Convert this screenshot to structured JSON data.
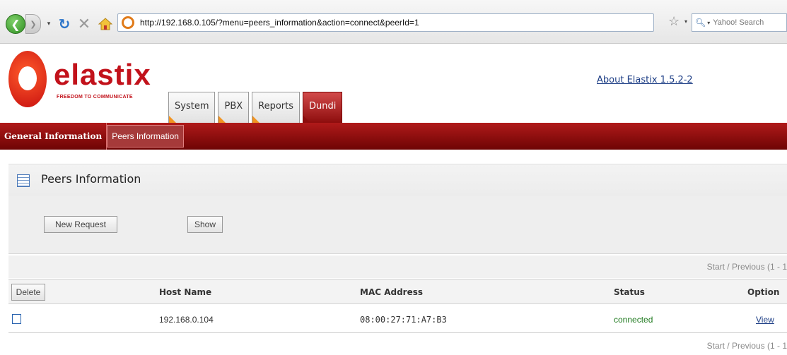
{
  "browser": {
    "url": "http://192.168.0.105/?menu=peers_information&action=connect&peerId=1",
    "search_placeholder": "Yahoo! Search"
  },
  "header": {
    "logo_text": "elastix",
    "logo_tagline": "FREEDOM TO COMMUNICATE",
    "about_link": "About Elastix 1.5.2-2",
    "menu_tabs": [
      {
        "label": "System"
      },
      {
        "label": "PBX"
      },
      {
        "label": "Reports"
      },
      {
        "label": "Dundi"
      }
    ]
  },
  "subnav": {
    "items": [
      {
        "label": "General Information"
      },
      {
        "label": "Peers Information"
      }
    ]
  },
  "page": {
    "title": "Peers Information",
    "new_request_label": "New Request",
    "show_label": "Show"
  },
  "pager": {
    "text": "Start  /  Previous (1 - 1"
  },
  "table": {
    "delete_label": "Delete",
    "columns": [
      "Host Name",
      "MAC Address",
      "Status",
      "Option"
    ],
    "rows": [
      {
        "host": "192.168.0.104",
        "mac": "08:00:27:71:A7:B3",
        "status": "connected",
        "option": "View"
      }
    ]
  },
  "colors": {
    "brand_red": "#c2121b",
    "subnav_red": "#8d0d0d",
    "status_green": "#1f7a1f",
    "link_blue": "#1c3d85"
  }
}
